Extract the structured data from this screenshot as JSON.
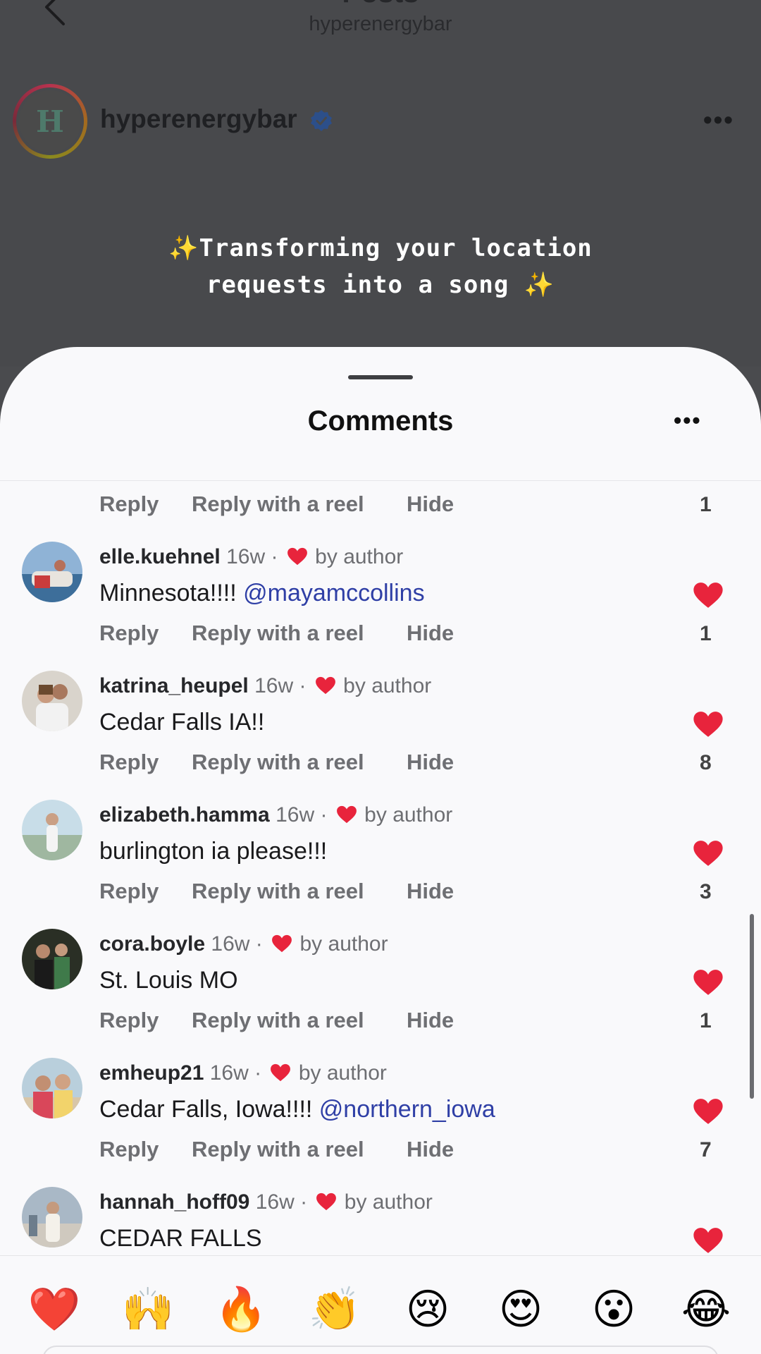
{
  "post": {
    "title": "Posts",
    "subtitle": "hyperenergybar",
    "author": "hyperenergybar",
    "avatar_text": "H",
    "caption_line1": "✨Transforming your location",
    "caption_line2": "requests into a song ✨"
  },
  "sheet": {
    "title": "Comments"
  },
  "actions": {
    "reply": "Reply",
    "reel": "Reply with a reel",
    "hide": "Hide"
  },
  "top_row": {
    "count": "1"
  },
  "comments": [
    {
      "user": "elle.kuehnel",
      "time": "16w",
      "by_author": "by author",
      "text": "Minnesota!!!! ",
      "mention": "@mayamccollins",
      "likes": "1"
    },
    {
      "user": "katrina_heupel",
      "time": "16w",
      "by_author": "by author",
      "text": "Cedar Falls IA!!",
      "mention": "",
      "likes": "8"
    },
    {
      "user": "elizabeth.hamma",
      "time": "16w",
      "by_author": "by author",
      "text": "burlington ia please!!!",
      "mention": "",
      "likes": "3"
    },
    {
      "user": "cora.boyle",
      "time": "16w",
      "by_author": "by author",
      "text": "St. Louis MO",
      "mention": "",
      "likes": "1"
    },
    {
      "user": "emheup21",
      "time": "16w",
      "by_author": "by author",
      "text": "Cedar Falls, Iowa!!!! ",
      "mention": "@northern_iowa",
      "likes": "7"
    },
    {
      "user": "hannah_hoff09",
      "time": "16w",
      "by_author": "by author",
      "text": "CEDAR FALLS",
      "mention": ""
    }
  ],
  "emojis": [
    "❤️",
    "🙌",
    "🔥",
    "👏",
    "😢",
    "😍",
    "😮",
    "😂"
  ],
  "colors": {
    "heart": "#e8243c",
    "mention": "#2f3fa6",
    "verified": "#3b6fd8"
  }
}
